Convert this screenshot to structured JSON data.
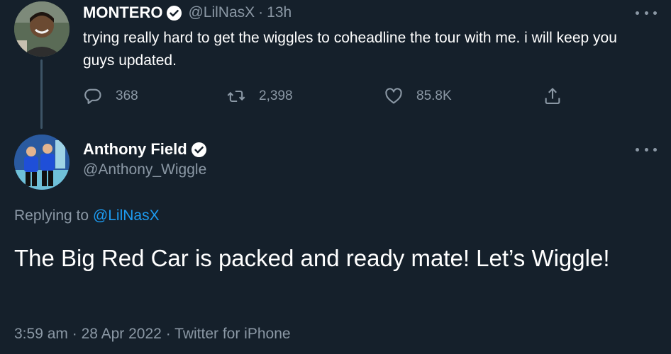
{
  "tweet1": {
    "name": "MONTERO",
    "handle": "@LilNasX",
    "separator": "·",
    "time": "13h",
    "text": "trying really hard to get the wiggles to coheadline the tour with me. i will keep you guys updated.",
    "replies": "368",
    "retweets": "2,398",
    "likes": "85.8K"
  },
  "tweet2": {
    "name": "Anthony Field",
    "handle": "@Anthony_Wiggle",
    "replying_prefix": "Replying to",
    "replying_handle": "@LilNasX",
    "text": "The Big Red Car is packed and ready mate! Let’s Wiggle!",
    "timestamp": "3:59 am",
    "date": "28 Apr 2022",
    "source": "Twitter for iPhone",
    "sep": "·"
  },
  "icons": {
    "verified": "verified-badge-icon",
    "reply": "reply-icon",
    "retweet": "retweet-icon",
    "like": "heart-icon",
    "share": "share-icon",
    "more": "more-icon"
  },
  "colors": {
    "background": "#15202b",
    "text": "#ffffff",
    "muted": "#8b98a5",
    "link": "#1d9bf0",
    "thread_line": "#3d5466"
  }
}
